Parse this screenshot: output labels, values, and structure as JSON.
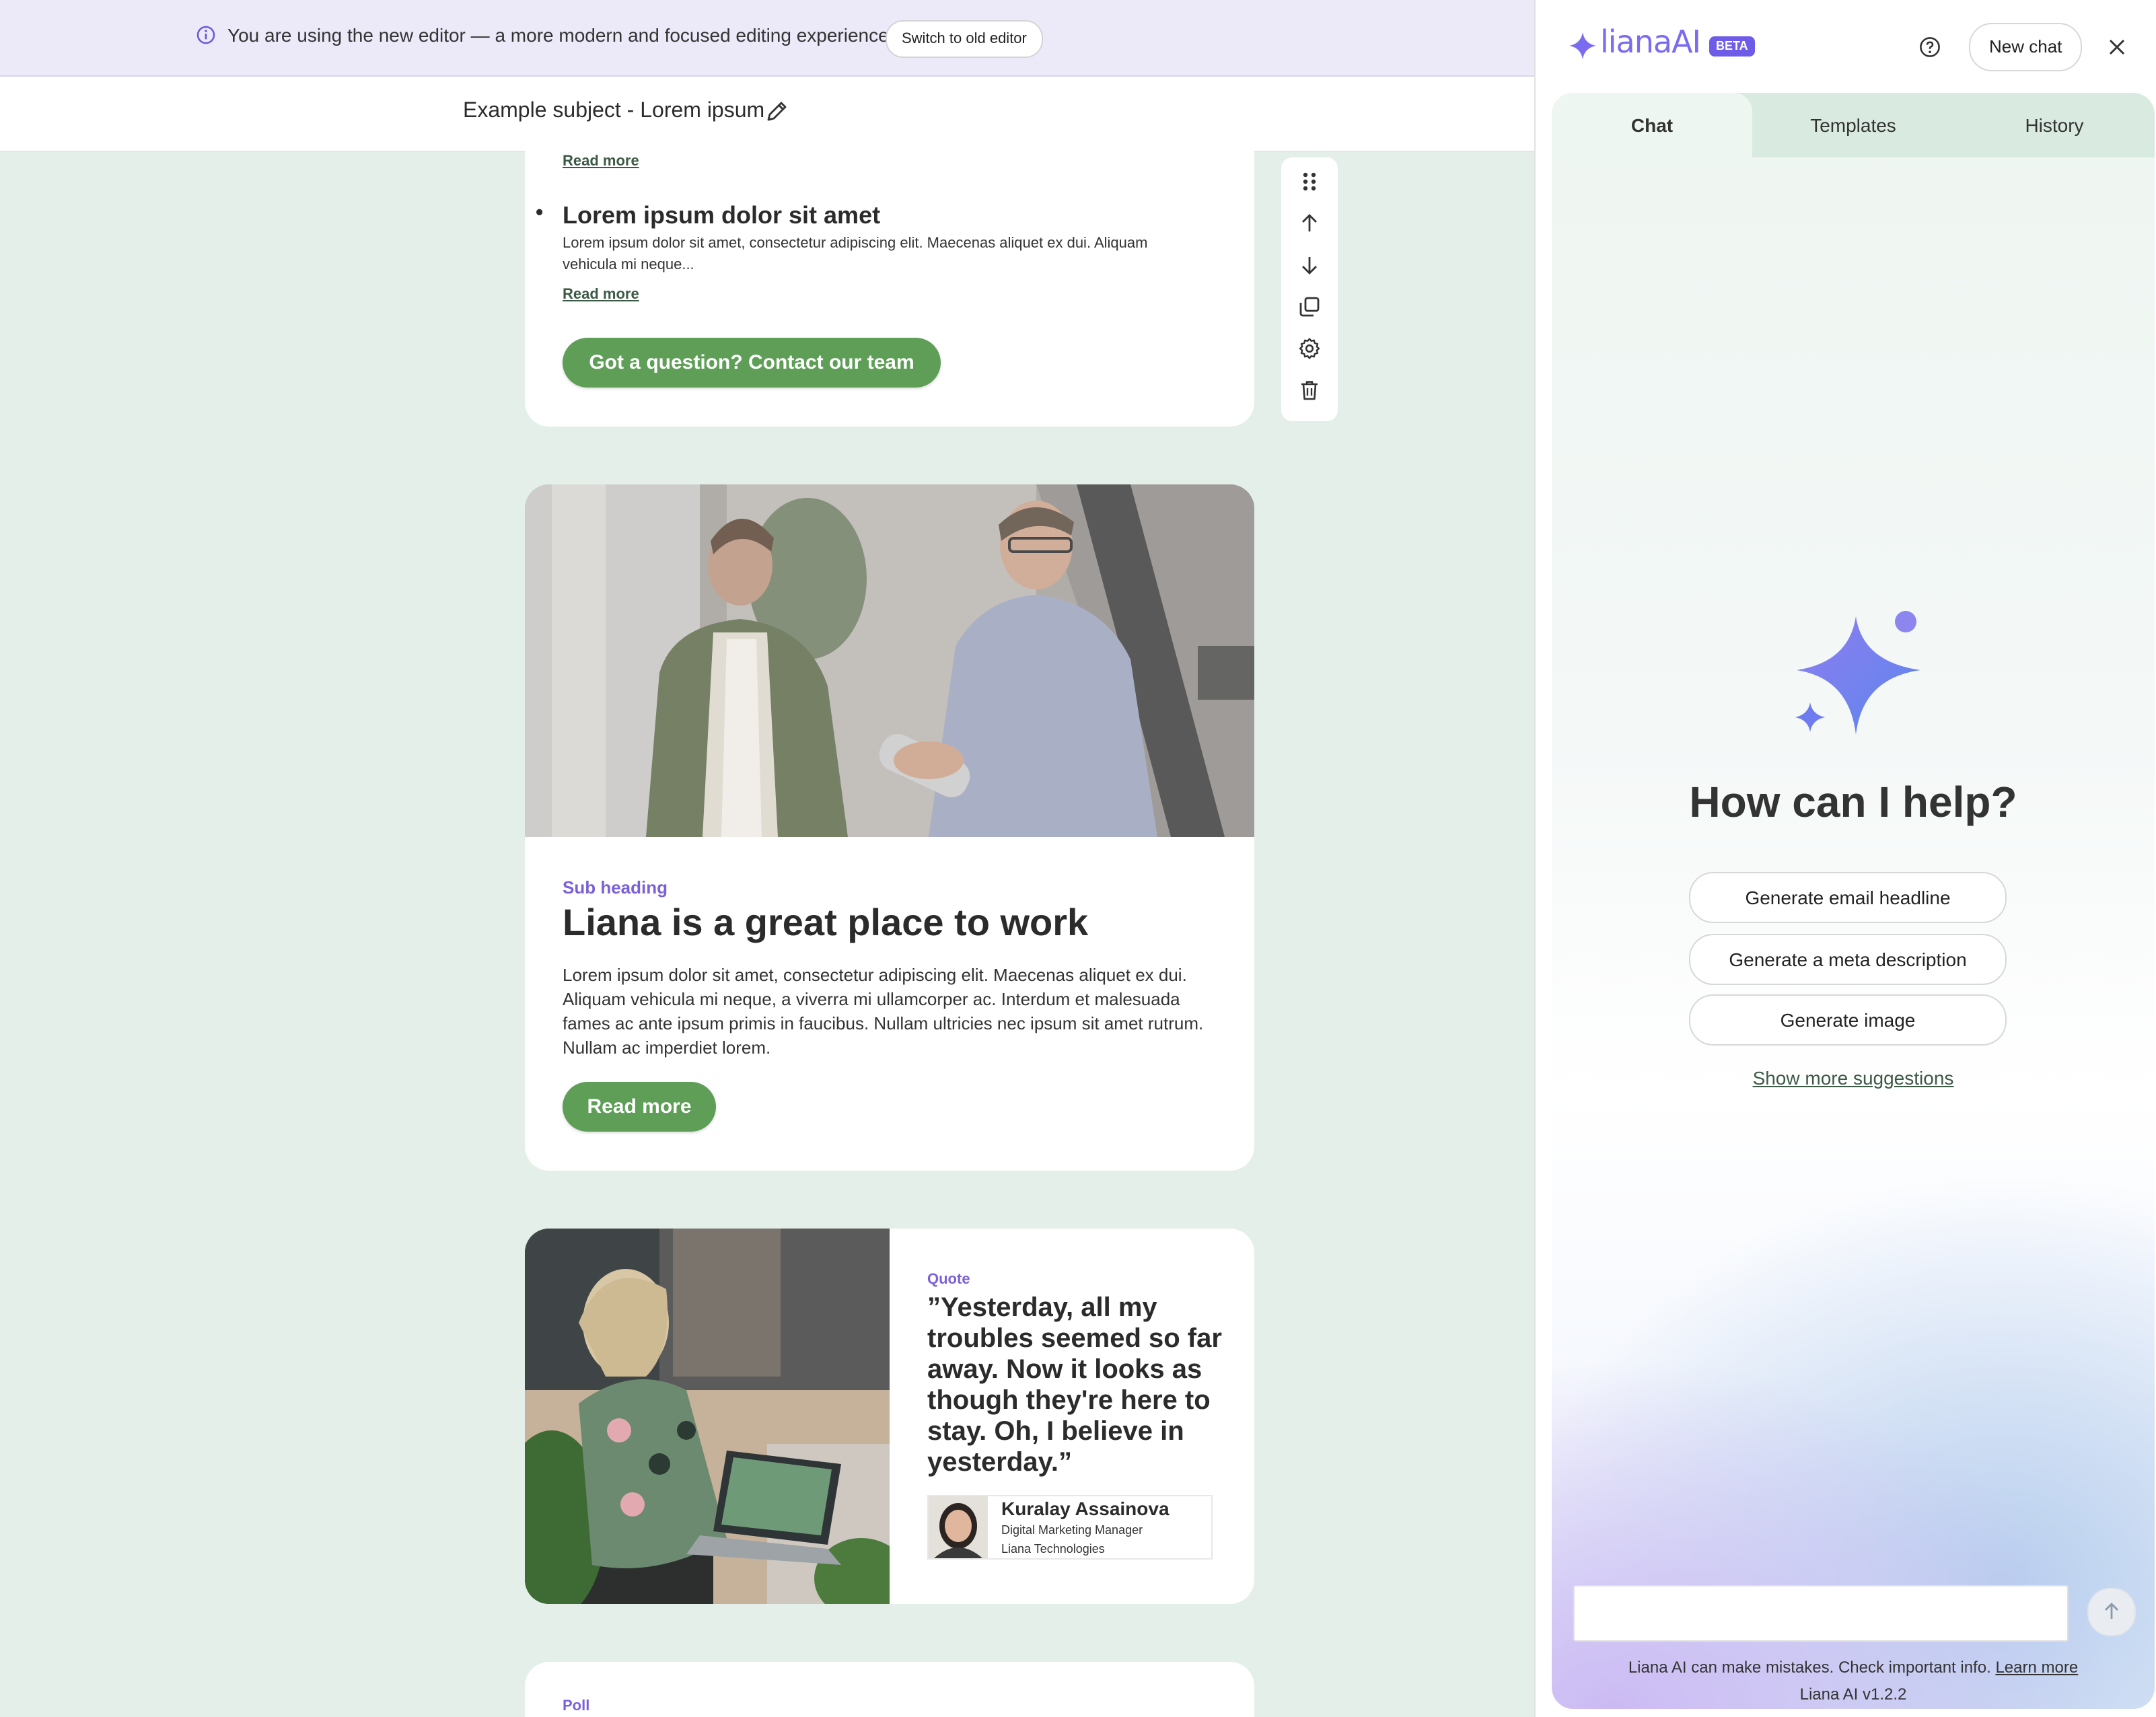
{
  "banner": {
    "message": "You are using the new editor — a more modern and focused editing experience.",
    "switch_label": "Switch to old editor"
  },
  "subject": {
    "text": "Example subject - Lorem ipsum"
  },
  "card1": {
    "read_more_top": "Read more",
    "bullet_title": "Lorem ipsum dolor sit amet",
    "bullet_body": "Lorem ipsum dolor sit amet, consectetur adipiscing elit. Maecenas aliquet ex dui. Aliquam vehicula mi neque...",
    "read_more": "Read more",
    "cta": "Got a question? Contact our team"
  },
  "card2": {
    "sub_heading": "Sub heading",
    "heading": "Liana is a great place to work",
    "paragraph": "Lorem ipsum dolor sit amet, consectetur adipiscing elit. Maecenas aliquet ex dui. Aliquam vehicula mi neque, a viverra mi ullamcorper ac. Interdum et malesuada fames ac ante ipsum primis in faucibus. Nullam ultricies nec ipsum sit amet rutrum. Nullam ac imperdiet lorem.",
    "button": "Read more"
  },
  "card3": {
    "label": "Quote",
    "quote": "”Yesterday, all my troubles seemed so far away. Now it looks as though they're here to stay. Oh, I believe in yesterday.”",
    "name": "Kuralay Assainova",
    "role": "Digital Marketing Manager",
    "company": "Liana Technologies"
  },
  "card4": {
    "label": "Poll"
  },
  "toolbar": {
    "icons": [
      "drag-handle-icon",
      "arrow-up-icon",
      "arrow-down-icon",
      "duplicate-icon",
      "settings-icon",
      "trash-icon"
    ]
  },
  "panel": {
    "logo_text": "lianaAI",
    "beta": "BETA",
    "new_chat": "New chat",
    "tabs": [
      "Chat",
      "Templates",
      "History"
    ],
    "active_tab": "Chat",
    "greeting": "How can I help?",
    "suggestions": [
      "Generate email headline",
      "Generate a meta description",
      "Generate image"
    ],
    "show_more": "Show more suggestions",
    "input_placeholder": "",
    "disclaimer": "Liana AI can make mistakes. Check important info.",
    "learn_more": "Learn more",
    "version": "Liana AI v1.2.2"
  },
  "colors": {
    "page_bg": "#e3efe8",
    "banner_bg": "#ece9f9",
    "green_button": "#5e9e57",
    "accent_purple": "#7b61d9",
    "ai_logo": "#7a6cf0"
  }
}
